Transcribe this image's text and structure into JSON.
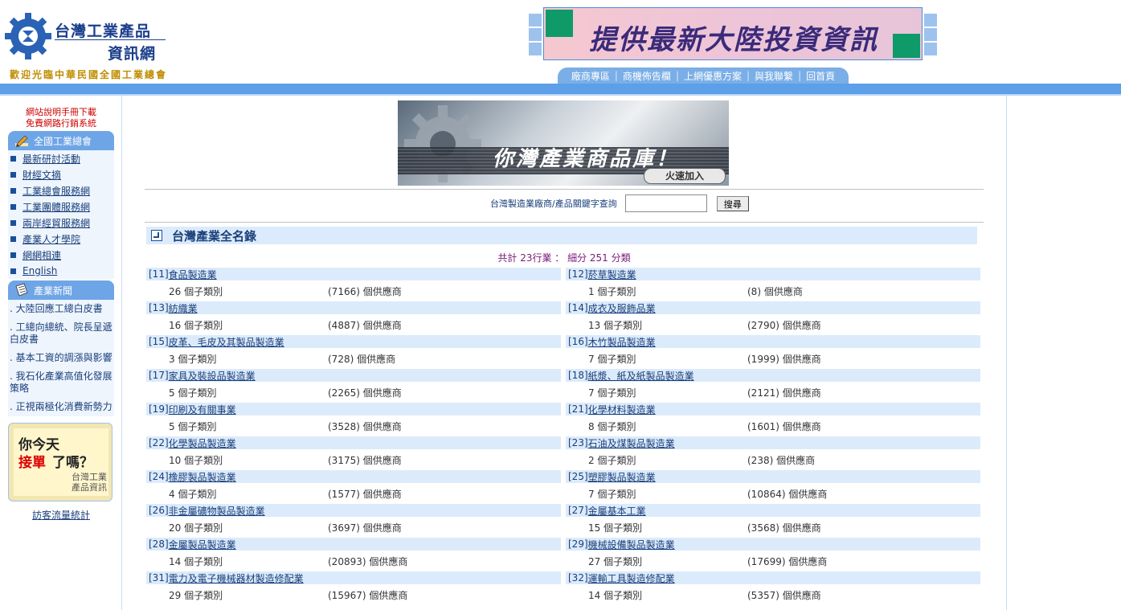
{
  "header": {
    "logo_line1": "台灣工業產品",
    "logo_line2": "資訊網",
    "welcome": "歡迎光臨中華民國全國工業總會",
    "banner_text": "提供最新大陸投資資訊",
    "nav": [
      "廠商專區",
      "商機佈告欄",
      "上網優惠方案",
      "與我聯繫",
      "回首頁"
    ],
    "nav_separator": "|"
  },
  "sidebar": {
    "top_links": [
      "網站說明手冊下載",
      "免費網路行銷系統"
    ],
    "section1_title": "全國工業總會",
    "section1_items": [
      "最新研討活動",
      "財經文摘",
      "工業總會服務網",
      "工業團體服務網",
      "兩岸經貿服務網",
      "產業人才學院",
      "網網相連",
      "English"
    ],
    "section2_title": "產業新聞",
    "news": [
      ". 大陸回應工總白皮書",
      ". 工總向總統、院長呈遞白皮書",
      ". 基本工資的調漲與影響",
      ". 我石化產業高值化發展策略",
      ". 正視兩極化消費新勢力"
    ],
    "ad": {
      "line1": "你今天",
      "line2a": "接單",
      "line2b": "了嗎？",
      "line3": "台灣工業",
      "line4": "產品資訊"
    },
    "visitor_stats": "訪客流量統計"
  },
  "main": {
    "banner": {
      "title": "你灣產業商品庫！",
      "button": "火速加入"
    },
    "search": {
      "label": "台灣製造業廠商∕產品關鍵字查詢",
      "value": "",
      "button": "搜尋"
    },
    "section_title": "台灣產業全名錄",
    "summary": "共計 23行業 ： 細分 251 分類",
    "industries": [
      {
        "code": "[11]",
        "name": "食品製造業",
        "sub": "26 個子類別",
        "suppliers": "(7166) 個供應商"
      },
      {
        "code": "[12]",
        "name": "菸草製造業",
        "sub": "1 個子類別",
        "suppliers": "(8) 個供應商"
      },
      {
        "code": "[13]",
        "name": "紡織業",
        "sub": "16 個子類別",
        "suppliers": "(4887) 個供應商"
      },
      {
        "code": "[14]",
        "name": "成衣及服飾品業",
        "sub": "13 個子類別",
        "suppliers": "(2790) 個供應商"
      },
      {
        "code": "[15]",
        "name": "皮革、毛皮及其製品製造業",
        "sub": "3 個子類別",
        "suppliers": "(728) 個供應商"
      },
      {
        "code": "[16]",
        "name": "木竹製品製造業",
        "sub": "7 個子類別",
        "suppliers": "(1999) 個供應商"
      },
      {
        "code": "[17]",
        "name": "家具及裝設品製造業",
        "sub": "5 個子類別",
        "suppliers": "(2265) 個供應商"
      },
      {
        "code": "[18]",
        "name": "紙漿、紙及紙製品製造業",
        "sub": "7 個子類別",
        "suppliers": "(2121) 個供應商"
      },
      {
        "code": "[19]",
        "name": "印刷及有關事業",
        "sub": "5 個子類別",
        "suppliers": "(3528) 個供應商"
      },
      {
        "code": "[21]",
        "name": "化學材料製造業",
        "sub": "8 個子類別",
        "suppliers": "(1601) 個供應商"
      },
      {
        "code": "[22]",
        "name": "化學製品製造業",
        "sub": "10 個子類別",
        "suppliers": "(3175) 個供應商"
      },
      {
        "code": "[23]",
        "name": "石油及煤製品製造業",
        "sub": "2 個子類別",
        "suppliers": "(238) 個供應商"
      },
      {
        "code": "[24]",
        "name": "橡膠製品製造業",
        "sub": "4 個子類別",
        "suppliers": "(1577) 個供應商"
      },
      {
        "code": "[25]",
        "name": "塑膠製品製造業",
        "sub": "7 個子類別",
        "suppliers": "(10864) 個供應商"
      },
      {
        "code": "[26]",
        "name": "非金屬礦物製品製造業",
        "sub": "20 個子類別",
        "suppliers": "(3697) 個供應商"
      },
      {
        "code": "[27]",
        "name": "金屬基本工業",
        "sub": "15 個子類別",
        "suppliers": "(3568) 個供應商"
      },
      {
        "code": "[28]",
        "name": "金屬製品製造業",
        "sub": "14 個子類別",
        "suppliers": "(20893) 個供應商"
      },
      {
        "code": "[29]",
        "name": "機械設備製品製造業",
        "sub": "27 個子類別",
        "suppliers": "(17699) 個供應商"
      },
      {
        "code": "[31]",
        "name": "電力及電子機械器材製造修配業",
        "sub": "29 個子類別",
        "suppliers": "(15967) 個供應商"
      },
      {
        "code": "[32]",
        "name": "運輸工具製造修配業",
        "sub": "14 個子類別",
        "suppliers": "(5357) 個供應商"
      }
    ]
  }
}
